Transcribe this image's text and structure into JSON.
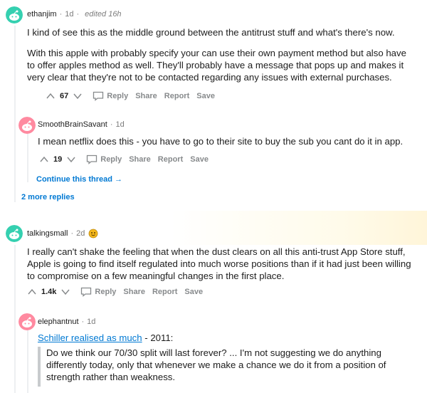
{
  "colors": {
    "accent": "#0079d3",
    "avatar_teal": "#35d0b0",
    "avatar_pink": "#ff8aa0",
    "meta_gray": "#7c7c7c",
    "action_gray": "#878a8c",
    "award_gold": "#f5b81c"
  },
  "comments": [
    {
      "username": "ethanjim",
      "age": "1d",
      "edited": "edited 16h",
      "avatar_icon": "snoo-avatar-icon",
      "paragraphs": [
        "I kind of see this as the middle ground between the antitrust stuff and what's there's now.",
        "With this apple with probably specify your can use their own payment method but also have to offer apples method as well. They'll probably have a message that pops up and makes it very clear that they're not to be contacted regarding any issues with external purchases."
      ],
      "score": "67",
      "actions": {
        "reply": "Reply",
        "share": "Share",
        "report": "Report",
        "save": "Save"
      }
    },
    {
      "username": "SmoothBrainSavant",
      "age": "1d",
      "avatar_icon": "snoo-avatar-icon",
      "paragraphs": [
        "I mean netflix does this - you have to go to their site to buy the sub you cant do it in app."
      ],
      "score": "19",
      "actions": {
        "reply": "Reply",
        "share": "Share",
        "report": "Report",
        "save": "Save"
      },
      "continue_thread": "Continue this thread",
      "continue_arrow": "→"
    },
    {
      "more_replies": "2 more replies"
    },
    {
      "username": "talkingsmall",
      "age": "2d",
      "avatar_icon": "snoo-avatar-icon",
      "award_icon": "award-icon",
      "paragraphs": [
        "I really can't shake the feeling that when the dust clears on all this anti-trust App Store stuff, Apple is going to find itself regulated into much worse positions than if it had just been willing to compromise on a few meaningful changes in the first place."
      ],
      "score": "1.4k",
      "actions": {
        "reply": "Reply",
        "share": "Share",
        "report": "Report",
        "save": "Save"
      }
    },
    {
      "username": "elephantnut",
      "age": "1d",
      "avatar_icon": "snoo-avatar-icon",
      "link_text": "Schiller realised as much",
      "link_suffix": " - 2011:",
      "quote": "Do we think our 70/30 split will last forever? ... I'm not suggesting we do anything differently today, only that whenever we make a chance we do it from a position of strength rather than weakness."
    }
  ],
  "separator": "·"
}
